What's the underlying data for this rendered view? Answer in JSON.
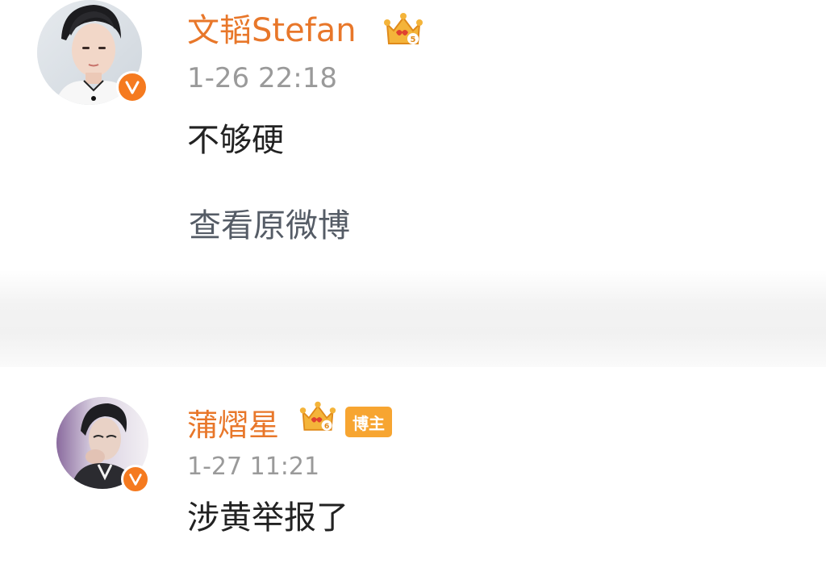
{
  "posts": [
    {
      "username": "文韬Stefan",
      "timestamp": "1-26 22:18",
      "content": "不够硬",
      "view_original": "查看原微博",
      "verified_icon": "verified-v-badge",
      "crown_icon": "vip-crown-icon"
    },
    {
      "username": "蒲熠星",
      "tag": "博主",
      "timestamp": "1-27 11:21",
      "content": "涉黄举报了",
      "verified_icon": "verified-v-badge",
      "crown_icon": "vip-crown-icon"
    }
  ],
  "colors": {
    "username": "#e8772a",
    "verified": "#f57a1f",
    "tag_bg": "#f7a531",
    "timestamp": "#9a9a9a",
    "content": "#222222",
    "link": "#555c66"
  }
}
